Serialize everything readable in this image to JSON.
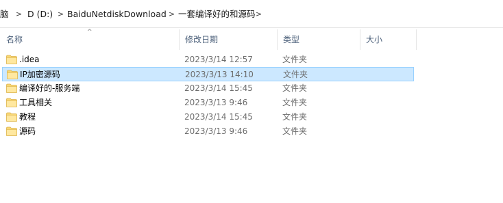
{
  "address_bar": {
    "segments": [
      "脑",
      "D (D:)",
      "BaiduNetdiskDownload",
      "一套编译好的和源码"
    ]
  },
  "columns": {
    "name": "名称",
    "date": "修改日期",
    "type": "类型",
    "size": "大小"
  },
  "files": [
    {
      "name": ".idea",
      "date": "2023/3/14 12:57",
      "type": "文件夹",
      "selected": false
    },
    {
      "name": "IP加密源码",
      "date": "2023/3/13 14:10",
      "type": "文件夹",
      "selected": true
    },
    {
      "name": "编译好的-服务端",
      "date": "2023/3/14 15:45",
      "type": "文件夹",
      "selected": false
    },
    {
      "name": "工具相关",
      "date": "2023/3/13 9:46",
      "type": "文件夹",
      "selected": false
    },
    {
      "name": "教程",
      "date": "2023/3/14 15:45",
      "type": "文件夹",
      "selected": false
    },
    {
      "name": "源码",
      "date": "2023/3/13 9:46",
      "type": "文件夹",
      "selected": false
    }
  ],
  "icons": {
    "folder": "folder-icon",
    "chevron": "chevron-right-icon",
    "sort": "sort-up-icon"
  },
  "colors": {
    "selection_bg": "#cce8ff",
    "selection_border": "#99d1ff",
    "folder_yellow": "#f8d775",
    "header_text": "#4c607a"
  }
}
